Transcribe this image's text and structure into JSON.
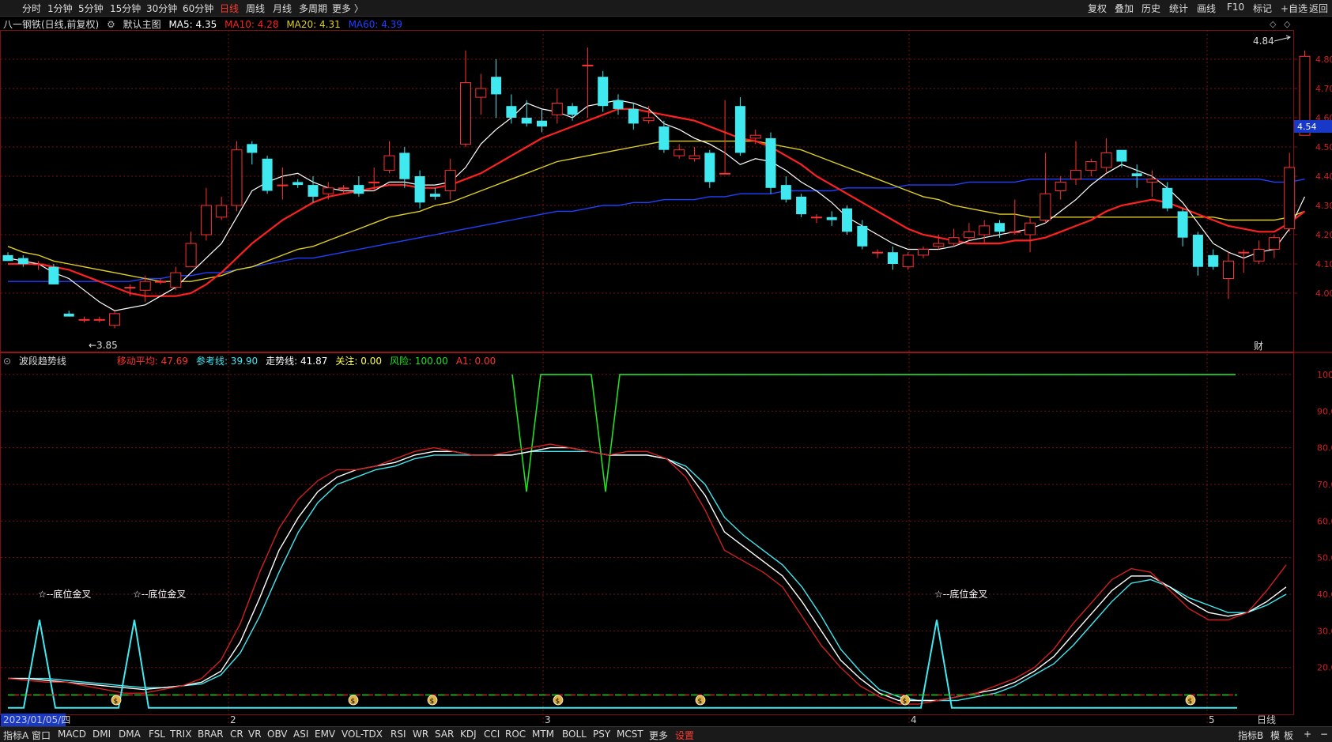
{
  "periods": [
    "分时",
    "1分钟",
    "5分钟",
    "15分钟",
    "30分钟",
    "60分钟",
    "日线",
    "周线",
    "月线",
    "多周期",
    "更多 〉"
  ],
  "active_period": "日线",
  "right_tools": [
    "复权",
    "叠加",
    "历史",
    "统计",
    "画线",
    "F10",
    "标记",
    "+自选",
    "返回"
  ],
  "stock": {
    "title": "八一钢铁(日线,前复权)",
    "main_label": "默认主图",
    "ma5": "MA5: 4.35",
    "ma10": "MA10: 4.28",
    "ma20": "MA20: 4.31",
    "ma60": "MA60: 4.39",
    "high_mark": "4.84",
    "low_mark": "3.85",
    "current_price": "4.54",
    "fin_mark": "财"
  },
  "colors": {
    "ma5": "#ffffff",
    "ma10": "#ff2020",
    "ma20": "#e0d020",
    "ma60": "#2040ff",
    "up": "#ff3030",
    "down": "#40e8f0",
    "grid": "#7a1010",
    "price_tag": "#1838c8"
  },
  "price_axis": [
    "4.80",
    "4.70",
    "4.60",
    "4.50",
    "4.40",
    "4.30",
    "4.20",
    "4.10",
    "4.00"
  ],
  "indicator": {
    "name": "波段趋势线",
    "fields": [
      {
        "label": "移动平均: 47.69",
        "color": "#ff3030"
      },
      {
        "label": "参考线: 39.90",
        "color": "#40e8f0"
      },
      {
        "label": "走势线: 41.87",
        "color": "#ffffff"
      },
      {
        "label": "关注: 0.00",
        "color": "#ffff40"
      },
      {
        "label": "风险: 100.00",
        "color": "#20e020"
      },
      {
        "label": "A1: 0.00",
        "color": "#ff3030"
      }
    ],
    "axis": [
      "100.0",
      "90.00",
      "80.00",
      "70.00",
      "60.00",
      "50.00",
      "40.00",
      "30.00",
      "20.00"
    ],
    "signal_label": "☆--底位金叉"
  },
  "dates": {
    "start": "2023/01/05/四",
    "month2": "2",
    "month3": "3",
    "month4": "4",
    "month5": "5",
    "period": "日线"
  },
  "chart_data": {
    "type": "candlestick",
    "candles": [
      [
        4.13,
        4.11,
        4.14,
        4.11
      ],
      [
        4.12,
        4.1,
        4.13,
        4.09
      ],
      [
        4.1,
        4.1,
        4.11,
        4.08
      ],
      [
        4.09,
        4.03,
        4.1,
        4.03
      ],
      [
        3.93,
        3.92,
        3.94,
        3.92
      ],
      [
        3.91,
        3.91,
        3.92,
        3.9
      ],
      [
        3.91,
        3.91,
        3.92,
        3.9
      ],
      [
        3.89,
        3.93,
        3.94,
        3.88
      ],
      [
        4.02,
        4.02,
        4.03,
        3.99
      ],
      [
        4.01,
        4.04,
        4.06,
        3.97
      ],
      [
        4.04,
        4.04,
        4.05,
        4.03
      ],
      [
        4.02,
        4.07,
        4.09,
        4.01
      ],
      [
        4.09,
        4.17,
        4.21,
        4.09
      ],
      [
        4.2,
        4.3,
        4.36,
        4.18
      ],
      [
        4.26,
        4.3,
        4.33,
        4.25
      ],
      [
        4.3,
        4.49,
        4.52,
        4.28
      ],
      [
        4.51,
        4.48,
        4.52,
        4.44
      ],
      [
        4.46,
        4.35,
        4.47,
        4.34
      ],
      [
        4.37,
        4.37,
        4.43,
        4.32
      ],
      [
        4.38,
        4.37,
        4.39,
        4.36
      ],
      [
        4.37,
        4.33,
        4.4,
        4.31
      ],
      [
        4.34,
        4.36,
        4.38,
        4.32
      ],
      [
        4.36,
        4.36,
        4.37,
        4.34
      ],
      [
        4.37,
        4.34,
        4.4,
        4.33
      ],
      [
        4.38,
        4.38,
        4.43,
        4.35
      ],
      [
        4.42,
        4.47,
        4.52,
        4.41
      ],
      [
        4.48,
        4.39,
        4.5,
        4.36
      ],
      [
        4.4,
        4.31,
        4.42,
        4.29
      ],
      [
        4.34,
        4.33,
        4.36,
        4.32
      ],
      [
        4.35,
        4.42,
        4.46,
        4.32
      ],
      [
        4.51,
        4.72,
        4.83,
        4.5
      ],
      [
        4.67,
        4.7,
        4.75,
        4.61
      ],
      [
        4.74,
        4.68,
        4.8,
        4.6
      ],
      [
        4.64,
        4.6,
        4.68,
        4.58
      ],
      [
        4.6,
        4.58,
        4.66,
        4.57
      ],
      [
        4.59,
        4.57,
        4.63,
        4.55
      ],
      [
        4.61,
        4.65,
        4.7,
        4.58
      ],
      [
        4.64,
        4.61,
        4.65,
        4.59
      ],
      [
        4.78,
        4.78,
        4.84,
        4.6
      ],
      [
        4.74,
        4.64,
        4.76,
        4.62
      ],
      [
        4.66,
        4.63,
        4.68,
        4.61
      ],
      [
        4.63,
        4.58,
        4.65,
        4.56
      ],
      [
        4.59,
        4.6,
        4.64,
        4.58
      ],
      [
        4.57,
        4.49,
        4.59,
        4.48
      ],
      [
        4.47,
        4.49,
        4.51,
        4.46
      ],
      [
        4.46,
        4.47,
        4.5,
        4.45
      ],
      [
        4.48,
        4.38,
        4.49,
        4.36
      ],
      [
        4.41,
        4.41,
        4.66,
        4.41
      ],
      [
        4.64,
        4.48,
        4.67,
        4.47
      ],
      [
        4.53,
        4.54,
        4.56,
        4.51
      ],
      [
        4.53,
        4.36,
        4.55,
        4.34
      ],
      [
        4.37,
        4.32,
        4.4,
        4.31
      ],
      [
        4.33,
        4.27,
        4.34,
        4.26
      ],
      [
        4.26,
        4.26,
        4.27,
        4.24
      ],
      [
        4.26,
        4.25,
        4.28,
        4.23
      ],
      [
        4.29,
        4.21,
        4.3,
        4.2
      ],
      [
        4.23,
        4.16,
        4.25,
        4.15
      ],
      [
        4.14,
        4.14,
        4.15,
        4.12
      ],
      [
        4.14,
        4.1,
        4.16,
        4.08
      ],
      [
        4.09,
        4.13,
        4.14,
        4.08
      ],
      [
        4.13,
        4.15,
        4.16,
        4.12
      ],
      [
        4.16,
        4.17,
        4.2,
        4.15
      ],
      [
        4.17,
        4.19,
        4.22,
        4.16
      ],
      [
        4.19,
        4.21,
        4.24,
        4.18
      ],
      [
        4.2,
        4.23,
        4.25,
        4.17
      ],
      [
        4.24,
        4.21,
        4.25,
        4.19
      ],
      [
        4.21,
        4.21,
        4.32,
        4.2
      ],
      [
        4.2,
        4.24,
        4.26,
        4.14
      ],
      [
        4.25,
        4.34,
        4.48,
        4.24
      ],
      [
        4.35,
        4.38,
        4.4,
        4.32
      ],
      [
        4.39,
        4.42,
        4.52,
        4.37
      ],
      [
        4.42,
        4.45,
        4.46,
        4.4
      ],
      [
        4.43,
        4.48,
        4.53,
        4.41
      ],
      [
        4.49,
        4.45,
        4.49,
        4.43
      ],
      [
        4.41,
        4.4,
        4.44,
        4.36
      ],
      [
        4.38,
        4.39,
        4.42,
        4.33
      ],
      [
        4.36,
        4.29,
        4.38,
        4.28
      ],
      [
        4.28,
        4.19,
        4.29,
        4.16
      ],
      [
        4.2,
        4.09,
        4.21,
        4.06
      ],
      [
        4.13,
        4.09,
        4.15,
        4.08
      ],
      [
        4.05,
        4.11,
        4.14,
        3.98
      ],
      [
        4.14,
        4.14,
        4.15,
        4.07
      ],
      [
        4.11,
        4.15,
        4.18,
        4.1
      ],
      [
        4.15,
        4.19,
        4.2,
        4.12
      ],
      [
        4.22,
        4.43,
        4.48,
        4.21
      ],
      [
        4.54,
        4.81,
        4.83,
        4.54
      ]
    ],
    "ma5": [
      4.12,
      4.11,
      4.1,
      4.07,
      4.05,
      4.01,
      3.97,
      3.94,
      3.95,
      3.96,
      3.99,
      4.02,
      4.07,
      4.12,
      4.17,
      4.26,
      4.35,
      4.38,
      4.4,
      4.41,
      4.38,
      4.36,
      4.35,
      4.35,
      4.35,
      4.38,
      4.38,
      4.37,
      4.37,
      4.38,
      4.43,
      4.51,
      4.56,
      4.6,
      4.65,
      4.63,
      4.62,
      4.6,
      4.64,
      4.65,
      4.66,
      4.65,
      4.63,
      4.58,
      4.56,
      4.53,
      4.51,
      4.48,
      4.44,
      4.46,
      4.45,
      4.42,
      4.38,
      4.35,
      4.31,
      4.26,
      4.23,
      4.2,
      4.17,
      4.15,
      4.15,
      4.15,
      4.16,
      4.18,
      4.19,
      4.2,
      4.21,
      4.22,
      4.24,
      4.28,
      4.32,
      4.37,
      4.41,
      4.44,
      4.42,
      4.4,
      4.36,
      4.31,
      4.24,
      4.17,
      4.14,
      4.12,
      4.14,
      4.15,
      4.22,
      4.33
    ],
    "ma10": [
      4.1,
      4.1,
      4.1,
      4.09,
      4.08,
      4.06,
      4.04,
      4.02,
      4.0,
      3.99,
      3.99,
      3.99,
      4.0,
      4.03,
      4.07,
      4.12,
      4.17,
      4.21,
      4.25,
      4.28,
      4.31,
      4.33,
      4.34,
      4.35,
      4.36,
      4.37,
      4.37,
      4.36,
      4.36,
      4.37,
      4.39,
      4.41,
      4.44,
      4.47,
      4.5,
      4.53,
      4.55,
      4.57,
      4.59,
      4.61,
      4.63,
      4.63,
      4.62,
      4.61,
      4.6,
      4.59,
      4.57,
      4.55,
      4.53,
      4.52,
      4.5,
      4.47,
      4.44,
      4.4,
      4.37,
      4.34,
      4.31,
      4.28,
      4.25,
      4.22,
      4.2,
      4.19,
      4.18,
      4.17,
      4.17,
      4.17,
      4.18,
      4.18,
      4.19,
      4.21,
      4.23,
      4.25,
      4.28,
      4.3,
      4.31,
      4.32,
      4.31,
      4.29,
      4.27,
      4.25,
      4.23,
      4.22,
      4.21,
      4.21,
      4.24,
      4.28
    ],
    "ma20": [
      4.16,
      4.14,
      4.13,
      4.11,
      4.1,
      4.09,
      4.08,
      4.07,
      4.06,
      4.05,
      4.04,
      4.04,
      4.04,
      4.05,
      4.06,
      4.08,
      4.09,
      4.11,
      4.13,
      4.15,
      4.16,
      4.18,
      4.2,
      4.22,
      4.24,
      4.26,
      4.27,
      4.28,
      4.3,
      4.31,
      4.33,
      4.35,
      4.37,
      4.39,
      4.41,
      4.43,
      4.45,
      4.46,
      4.47,
      4.48,
      4.49,
      4.5,
      4.51,
      4.52,
      4.52,
      4.52,
      4.52,
      4.52,
      4.52,
      4.52,
      4.51,
      4.5,
      4.49,
      4.47,
      4.45,
      4.43,
      4.41,
      4.39,
      4.37,
      4.35,
      4.33,
      4.32,
      4.3,
      4.29,
      4.28,
      4.27,
      4.27,
      4.26,
      4.26,
      4.26,
      4.26,
      4.26,
      4.26,
      4.26,
      4.26,
      4.26,
      4.26,
      4.26,
      4.26,
      4.26,
      4.25,
      4.25,
      4.25,
      4.25,
      4.26,
      4.28
    ],
    "ma60": [
      4.04,
      4.04,
      4.04,
      4.04,
      4.04,
      4.04,
      4.04,
      4.04,
      4.04,
      4.05,
      4.05,
      4.06,
      4.06,
      4.07,
      4.07,
      4.08,
      4.09,
      4.1,
      4.11,
      4.12,
      4.12,
      4.13,
      4.14,
      4.15,
      4.16,
      4.17,
      4.18,
      4.19,
      4.2,
      4.21,
      4.22,
      4.23,
      4.24,
      4.25,
      4.26,
      4.27,
      4.28,
      4.28,
      4.29,
      4.3,
      4.3,
      4.31,
      4.31,
      4.32,
      4.32,
      4.32,
      4.33,
      4.33,
      4.34,
      4.34,
      4.34,
      4.35,
      4.35,
      4.35,
      4.35,
      4.36,
      4.36,
      4.36,
      4.36,
      4.37,
      4.37,
      4.37,
      4.37,
      4.38,
      4.38,
      4.38,
      4.38,
      4.39,
      4.39,
      4.39,
      4.39,
      4.39,
      4.39,
      4.39,
      4.39,
      4.39,
      4.39,
      4.39,
      4.39,
      4.39,
      4.39,
      4.39,
      4.39,
      4.38,
      4.38,
      4.39
    ],
    "ind_red": [
      17,
      16.5,
      16,
      16,
      15,
      14,
      13,
      13,
      14,
      15,
      17,
      22,
      32,
      46,
      58,
      66,
      71,
      74,
      74,
      75,
      77,
      79,
      80,
      79,
      78,
      78,
      79,
      80,
      81,
      80,
      79,
      78,
      79,
      79,
      77,
      72,
      63,
      52,
      49,
      46,
      42,
      34,
      26,
      20,
      15,
      12,
      10,
      10,
      11,
      12,
      13,
      15,
      17,
      20,
      25,
      32,
      38,
      44,
      47,
      46,
      41,
      36,
      33,
      33,
      35,
      41,
      48
    ],
    "ind_white": [
      17,
      17,
      16.5,
      16,
      15.5,
      15,
      14.5,
      14,
      14.5,
      15,
      16,
      19,
      27,
      39,
      52,
      61,
      68,
      72,
      74,
      75,
      76,
      78,
      79,
      79,
      78,
      78,
      78,
      79,
      80,
      80,
      79,
      78,
      78,
      78,
      77,
      74,
      67,
      57,
      53,
      49,
      45,
      38,
      30,
      22,
      17,
      13,
      11,
      11,
      11,
      12,
      13,
      14,
      16,
      19,
      23,
      29,
      35,
      41,
      45,
      45,
      42,
      38,
      35,
      34,
      35,
      38,
      42
    ],
    "ind_cyan": [
      17,
      17,
      17,
      16.5,
      16,
      15.5,
      15,
      14.5,
      14.5,
      15,
      15.5,
      18,
      24,
      34,
      46,
      57,
      65,
      70,
      72,
      74,
      75,
      77,
      78,
      78,
      78,
      78,
      78,
      79,
      79,
      79,
      79,
      78,
      78,
      78,
      77,
      75,
      70,
      61,
      56,
      52,
      48,
      42,
      34,
      25,
      19,
      14,
      12,
      11,
      11,
      11,
      12,
      13,
      15,
      18,
      21,
      26,
      32,
      38,
      43,
      44,
      42,
      39,
      37,
      35,
      35,
      37,
      40
    ]
  }
}
